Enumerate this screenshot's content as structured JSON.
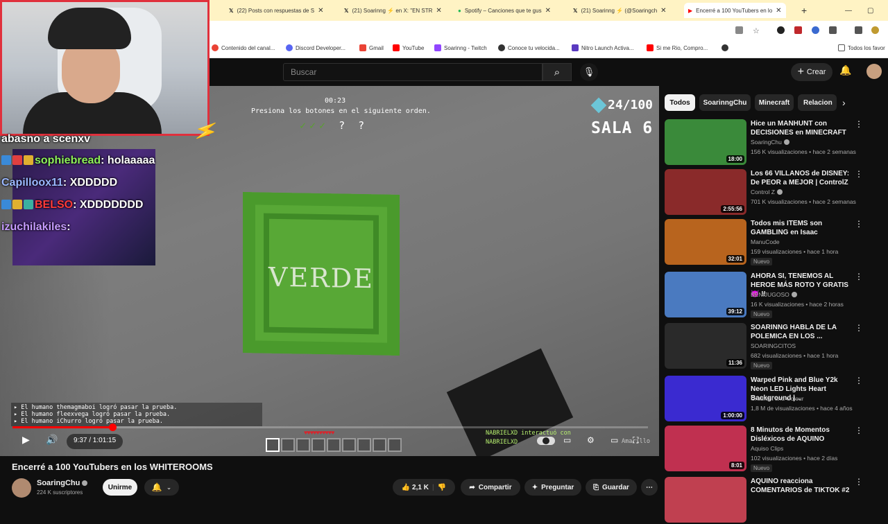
{
  "browser": {
    "tabs": [
      {
        "label": "(22) Posts con respuestas de S",
        "icon": "x-icon"
      },
      {
        "label": "(21) Soarinng ⚡ en X: \"EN STR",
        "icon": "x-icon"
      },
      {
        "label": "Spotify – Canciones que te gus",
        "icon": "spotify-icon"
      },
      {
        "label": "(21) Soarinng ⚡ (@Soaringch",
        "icon": "x-icon"
      },
      {
        "label": "Encerré a 100 YouTubers en lo",
        "icon": "youtube-icon"
      }
    ],
    "bookmarks": [
      "Contenido del canal...",
      "Discord Developer...",
      "Gmail",
      "YouTube",
      "Soarinng - Twitch",
      "Conoce tu velocida...",
      "Nitro Launch Activa...",
      "Si me Rio, Compro...",
      "Todos los favor"
    ]
  },
  "header": {
    "search_placeholder": "Buscar",
    "create_label": "Crear"
  },
  "player": {
    "game": {
      "timer": "00:23",
      "instruction": "Presiona los botones en el siguiente orden.",
      "checks": "✓✓✓",
      "unknown": "? ?",
      "counter": "24/100",
      "room": "SALA 6",
      "block_word": "VERDE",
      "log_lines": [
        "▸ El humano themagmaboi logró pasar la prueba.",
        "▸ El humano fleexvega logró pasar la prueba.",
        "▸ El humano iChurro logró pasar la prueba."
      ],
      "right_log": [
        "NABRIELXD interactuó con",
        "NABRIELXD"
      ],
      "right_log_extra": "Amarillo"
    },
    "time": "9:37 / 1:01:15",
    "progress_fraction": 0.157
  },
  "stream_overlay": {
    "chat_top_line": "abasno a scenxv",
    "chat": [
      {
        "user": "sophiebread",
        "msg": ": holaaaaa",
        "color": "u1"
      },
      {
        "user": "Capilloox11",
        "msg": ": XDDDDD",
        "color": "u2"
      },
      {
        "user": "BELSO",
        "msg": ": XDDDDDDD",
        "color": "u3"
      },
      {
        "user": "izuchilakiles",
        "msg": ":",
        "color": "u4"
      }
    ]
  },
  "video": {
    "title": "Encerré a 100 YouTubers en los WHITEROOMS",
    "channel": "SoaringChu",
    "subscribers": "224 K suscriptores",
    "subscribe_label": "Unirme",
    "likes": "2,1 K",
    "share_label": "Compartir",
    "ask_label": "Preguntar",
    "save_label": "Guardar"
  },
  "sidebar": {
    "chips": [
      "Todos",
      "SoarinngChu",
      "Minecraft",
      "Relacion"
    ],
    "recommendations": [
      {
        "title": "Hice un MANHUNT con DECISIONES en MINECRAFT",
        "channel": "SoaringChu",
        "verified": true,
        "meta": "156 K visualizaciones • hace 2 semanas",
        "duration": "18:00",
        "new": false,
        "thumb": "#3a8a3a"
      },
      {
        "title": "Los 66 VILLANOS de DISNEY: De PEOR a MEJOR | ControlZ",
        "channel": "Control Z",
        "verified": true,
        "meta": "701 K visualizaciones • hace 2 semanas",
        "duration": "2:55:56",
        "new": false,
        "thumb": "#8a2a2a"
      },
      {
        "title": "Todos mis ITEMS son GAMBLING en Isaac",
        "channel": "ManuCode",
        "verified": false,
        "meta": "159 visualizaciones • hace 1 hora",
        "duration": "32:01",
        "new": true,
        "thumb": "#b8641e"
      },
      {
        "title": "AHORA SI, TENEMOS AL HEROE MÁS ROTO Y GRATIS 😈 !!",
        "channel": "BENIJUGOSO",
        "verified": true,
        "meta": "16 K visualizaciones • hace 2 horas",
        "duration": "39:12",
        "new": true,
        "thumb": "#4a7ac0"
      },
      {
        "title": "SOARINNG HABLA DE LA POLEMICA EN LOS ...",
        "channel": "SOARINGCITOS",
        "verified": false,
        "meta": "682 visualizaciones • hace 1 hora",
        "duration": "11:36",
        "new": true,
        "thumb": "#2a2a2a"
      },
      {
        "title": "Warped Pink and Blue Y2k Neon LED Lights Heart Background |...",
        "channel": "Gradient and Colour",
        "verified": false,
        "meta": "1,8 M de visualizaciones • hace 4 años",
        "duration": "1:00:00",
        "new": false,
        "thumb": "#3a2ad0"
      },
      {
        "title": "8 Minutos de Momentos Disléxicos de AQUINO",
        "channel": "Aquiso Clips",
        "verified": false,
        "meta": "102 visualizaciones • hace 2 días",
        "duration": "8:01",
        "new": true,
        "thumb": "#c03050"
      },
      {
        "title": "AQUINO reacciona COMENTARIOS de TIKTOK #2",
        "channel": "",
        "verified": false,
        "meta": "",
        "duration": "",
        "new": false,
        "thumb": "#c04050"
      }
    ]
  }
}
